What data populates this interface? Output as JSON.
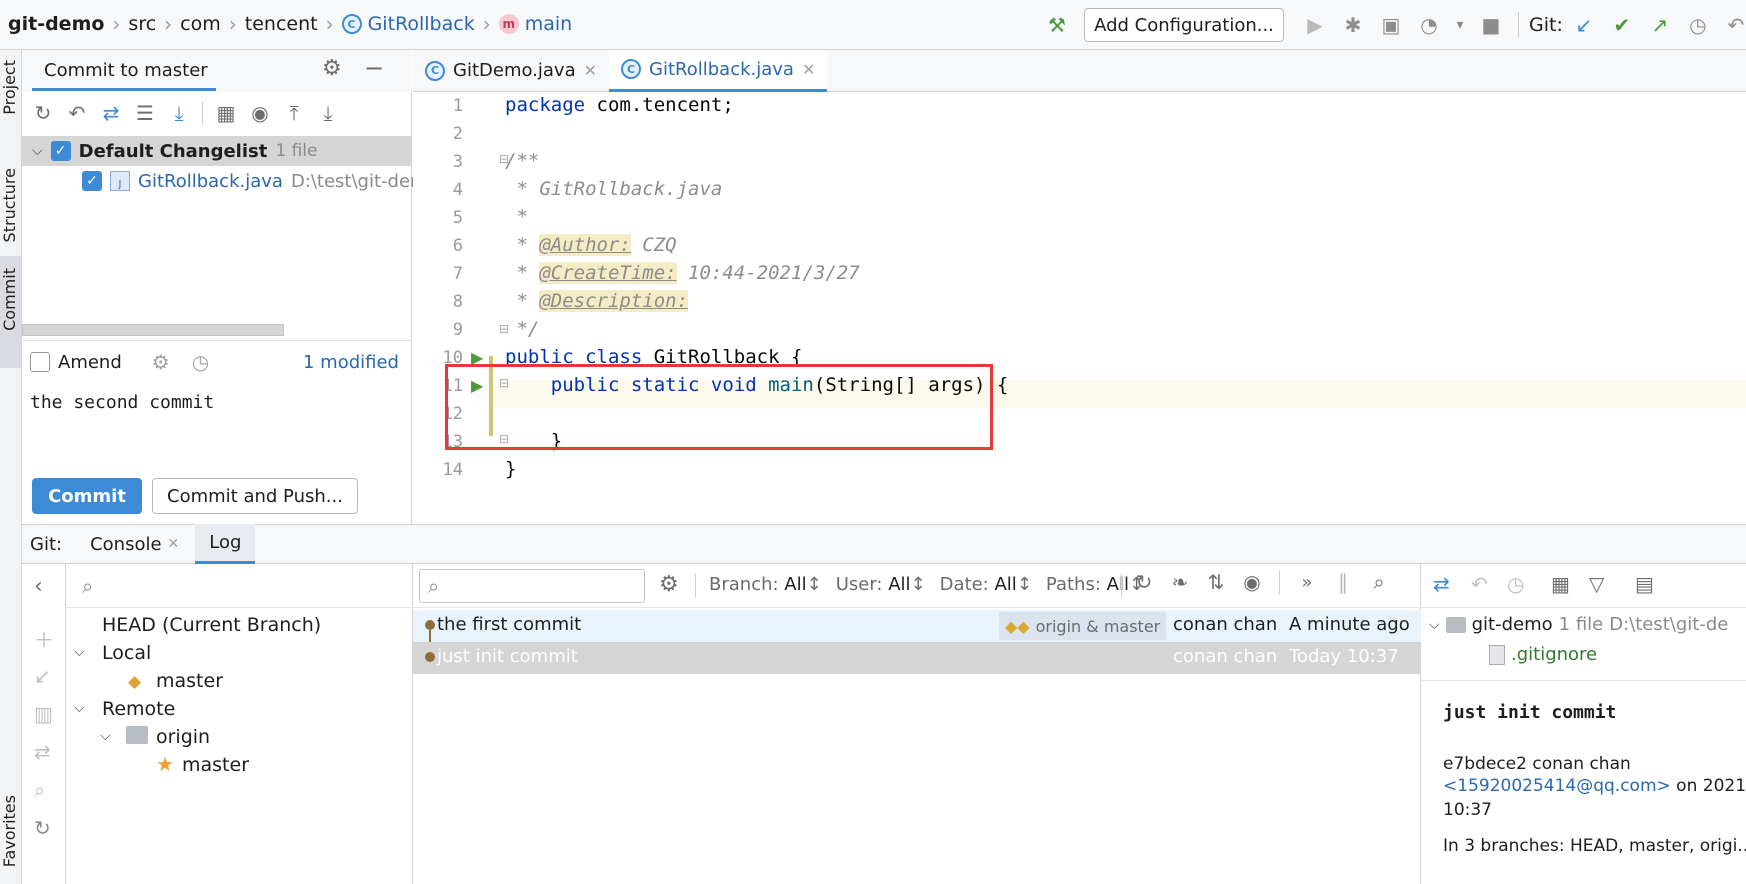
{
  "navbar": {
    "crumbs": [
      "git-demo",
      "src",
      "com",
      "tencent",
      "GitRollback",
      "main"
    ],
    "add_configuration": "Add Configuration...",
    "git_label": "Git:"
  },
  "left_stripe": {
    "project": "Project",
    "structure": "Structure",
    "commit": "Commit",
    "favorites": "Favorites"
  },
  "commit_panel": {
    "title": "Commit to master",
    "changelist": {
      "name": "Default Changelist",
      "count": "1 file"
    },
    "file": {
      "name": "GitRollback.java",
      "path": "D:\\test\\git-der"
    },
    "amend": "Amend",
    "modified": "1 modified",
    "message": "the second commit",
    "commit_button": "Commit",
    "commit_push_button": "Commit and Push..."
  },
  "editor": {
    "tabs": [
      {
        "label": "GitDemo.java"
      },
      {
        "label": "GitRollback.java"
      }
    ],
    "lines": [
      {
        "n": "1"
      },
      {
        "n": "2"
      },
      {
        "n": "3"
      },
      {
        "n": "4"
      },
      {
        "n": "5"
      },
      {
        "n": "6"
      },
      {
        "n": "7"
      },
      {
        "n": "8"
      },
      {
        "n": "9"
      },
      {
        "n": "10"
      },
      {
        "n": "11"
      },
      {
        "n": "12"
      },
      {
        "n": "13"
      },
      {
        "n": "14"
      }
    ],
    "code": {
      "l1_kw": "package",
      "l1_rest": " com.tencent;",
      "l3": "/**",
      "l4": " * GitRollback.java",
      "l5": " *",
      "l6_pre": " * ",
      "l6_tag": "@Author:",
      "l6_val": " CZQ",
      "l7_pre": " * ",
      "l7_tag": "@CreateTime:",
      "l7_val": " 10:44-2021/3/27",
      "l8_pre": " * ",
      "l8_tag": "@Description:",
      "l9": " */",
      "l10_kw": "public class",
      "l10_rest": " GitRollback {",
      "l11_pre": "    ",
      "l11_kw": "public static void",
      "l11_name": " main",
      "l11_rest": "(String[] args) {",
      "l13": "    }",
      "l14": "}"
    }
  },
  "bottom": {
    "git_label": "Git:",
    "tab_console": "Console",
    "tab_log": "Log",
    "branches": {
      "head": "HEAD (Current Branch)",
      "local": "Local",
      "local_master": "master",
      "remote": "Remote",
      "origin": "origin",
      "remote_master": "master"
    },
    "filters": {
      "branch_label": "Branch:",
      "branch_value": "All",
      "user_label": "User:",
      "user_value": "All",
      "date_label": "Date:",
      "date_value": "All",
      "paths_label": "Paths:",
      "paths_value": "All"
    },
    "commits": [
      {
        "message": "the first commit",
        "refs": "origin & master",
        "author": "conan chan",
        "date": "A minute ago"
      },
      {
        "message": "just init commit",
        "refs": "",
        "author": "conan chan",
        "date": "Today 10:37"
      }
    ],
    "details": {
      "repo": "git-demo",
      "count": "1 file",
      "path": "D:\\test\\git-de",
      "file": ".gitignore",
      "subject": "just init commit",
      "hash_author": "e7bdece2 conan chan",
      "email": "<15920025414@qq.com>",
      "on_date": "on 2021",
      "time": "10:37",
      "branches_line": "In 3 branches: HEAD, master, origi..."
    }
  },
  "colors": {
    "accent": "#3d8bd6",
    "selection_row": "#e9f3fb",
    "selected_row_gray": "#d5d5d5",
    "highlight_box": "#e53935"
  }
}
